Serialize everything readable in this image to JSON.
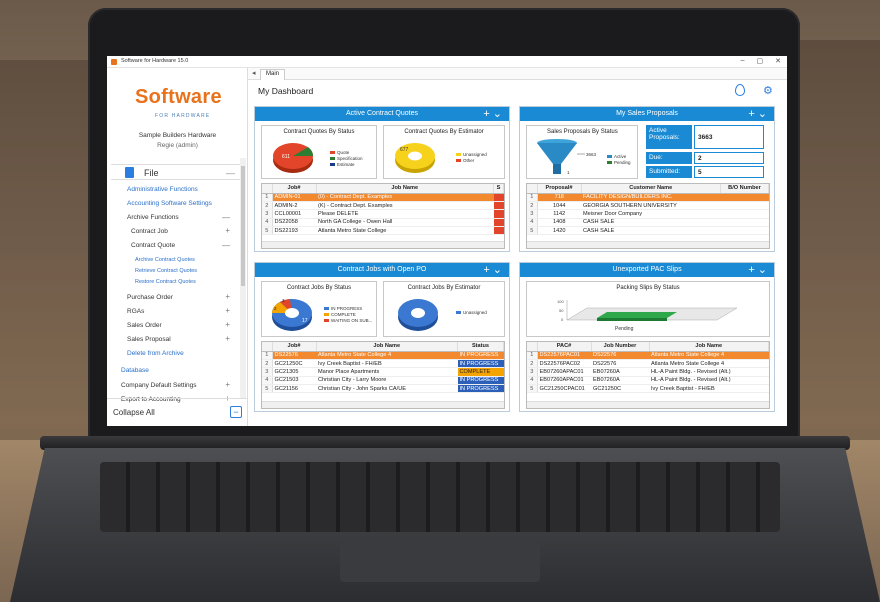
{
  "window": {
    "title": "Software for Hardware 15.0",
    "controls": [
      "–",
      "▢",
      "✕"
    ]
  },
  "brand": {
    "logo_word": "Software",
    "logo_sub": "FOR HARDWARE",
    "company": "Sample Builders Hardware",
    "user": "Regie (admin)"
  },
  "sidebar": {
    "file_label": "File",
    "items": [
      "Administrative Functions",
      "Accounting Software Settings",
      "Archive Functions",
      "Contract Job",
      "Contract Quote",
      "Archive Contract Quotes",
      "Retrieve Contract Quotes",
      "Restore Contract Quotes",
      "Purchase Order",
      "RGAs",
      "Sales Order",
      "Sales Proposal",
      "Delete from Archive",
      "Database",
      "Company Default Settings",
      "Export to Accounting"
    ],
    "collapse_all": "Collapse All"
  },
  "tabs": {
    "main": "Main"
  },
  "dashboard": {
    "title": "My Dashboard"
  },
  "panels": {
    "quotes": {
      "title": "Active Contract Quotes",
      "chart1_title": "Contract Quotes By Status",
      "chart1_legend": [
        "Quote",
        "Specification",
        "Estimate"
      ],
      "chart1_label": "611",
      "chart2_title": "Contract Quotes By Estimator",
      "chart2_legend": [
        "Unassigned",
        "Other"
      ],
      "chart2_label": "677",
      "cols": [
        "Job#",
        "Job Name",
        "S"
      ],
      "rows": [
        [
          "1",
          "ADMIN-01",
          "(0) - Contract Dept. Examples"
        ],
        [
          "2",
          "ADMIN-2",
          "(K) - Contract Dept. Examples"
        ],
        [
          "3",
          "CCL00001",
          "Please DELETE"
        ],
        [
          "4",
          "DS22058",
          "North GA College - Owen Hall"
        ],
        [
          "5",
          "DS22193",
          "Atlanta Metro State College"
        ]
      ]
    },
    "proposals": {
      "title": "My Sales Proposals",
      "chart_title": "Sales Proposals By Status",
      "chart_legend": [
        "Active",
        "Pending"
      ],
      "funnel_labels": [
        "3663",
        "1"
      ],
      "kv": [
        [
          "Active Proposals:",
          "3663"
        ],
        [
          "Due:",
          "2"
        ],
        [
          "Submitted:",
          "5"
        ]
      ],
      "cols": [
        "Proposal#",
        "Customer Name",
        "B/O Number"
      ],
      "rows": [
        [
          "1",
          "718",
          "FACILITY DESIGN/BUILDERS INC."
        ],
        [
          "2",
          "1044",
          "GEORGIA SOUTHERN UNIVERSITY"
        ],
        [
          "3",
          "1142",
          "Meisner Door Company"
        ],
        [
          "4",
          "1408",
          "CASH SALE"
        ],
        [
          "5",
          "1420",
          "CASH SALE"
        ]
      ]
    },
    "jobs": {
      "title": "Contract Jobs with Open PO",
      "chart1_title": "Contract Jobs By Status",
      "chart1_legend": [
        "IN PROGRESS",
        "COMPLETE",
        "WAITING ON SUB..."
      ],
      "chart1_labels": [
        "17",
        "2",
        "3"
      ],
      "chart2_title": "Contract Jobs By Estimator",
      "chart2_legend": [
        "Unassigned"
      ],
      "cols": [
        "Job#",
        "Job Name",
        "Status"
      ],
      "rows": [
        [
          "1",
          "DS22576",
          "Atlanta Metro State College 4",
          "IN PROGRESS"
        ],
        [
          "2",
          "GC21250C",
          "Ivy Creek Baptist - FH/EB",
          "IN PROGRESS"
        ],
        [
          "3",
          "GC21305",
          "Manor Place Apartments",
          "COMPLETE"
        ],
        [
          "4",
          "GC21503",
          "Christian City - Larry Moore",
          "IN PROGRESS"
        ],
        [
          "5",
          "GC21156",
          "Christian City - John Sparks CA/UE",
          "IN PROGRESS"
        ]
      ]
    },
    "pac": {
      "title": "Unexported PAC Slips",
      "chart_title": "Packing Slips By Status",
      "chart_axis_label": "Pending",
      "chart_y_ticks": [
        "100",
        "50",
        "0"
      ],
      "cols": [
        "PAC#",
        "Job Number",
        "Job Name"
      ],
      "rows": [
        [
          "1",
          "DS22576PAC01",
          "DS22576",
          "Atlanta Metro State College 4"
        ],
        [
          "2",
          "DS22576PAC02",
          "DS22576",
          "Atlanta Metro State College 4"
        ],
        [
          "3",
          "EB07260APAC01",
          "EB07260A",
          "HL-A Paint Bldg. - Revised (Alt.)"
        ],
        [
          "4",
          "EB07260APAC01",
          "EB07260A",
          "HL-A Paint Bldg. - Revised (Alt.)"
        ],
        [
          "5",
          "GC21250CPAC01",
          "GC21250C",
          "Ivy Creek Baptist - FH/EB"
        ]
      ]
    }
  },
  "colors": {
    "accent": "#1a8ad4",
    "brand_orange": "#e8731c",
    "selected_row": "#f2892f",
    "status_blue": "#2b5fb8",
    "status_orange": "#f4a300"
  }
}
